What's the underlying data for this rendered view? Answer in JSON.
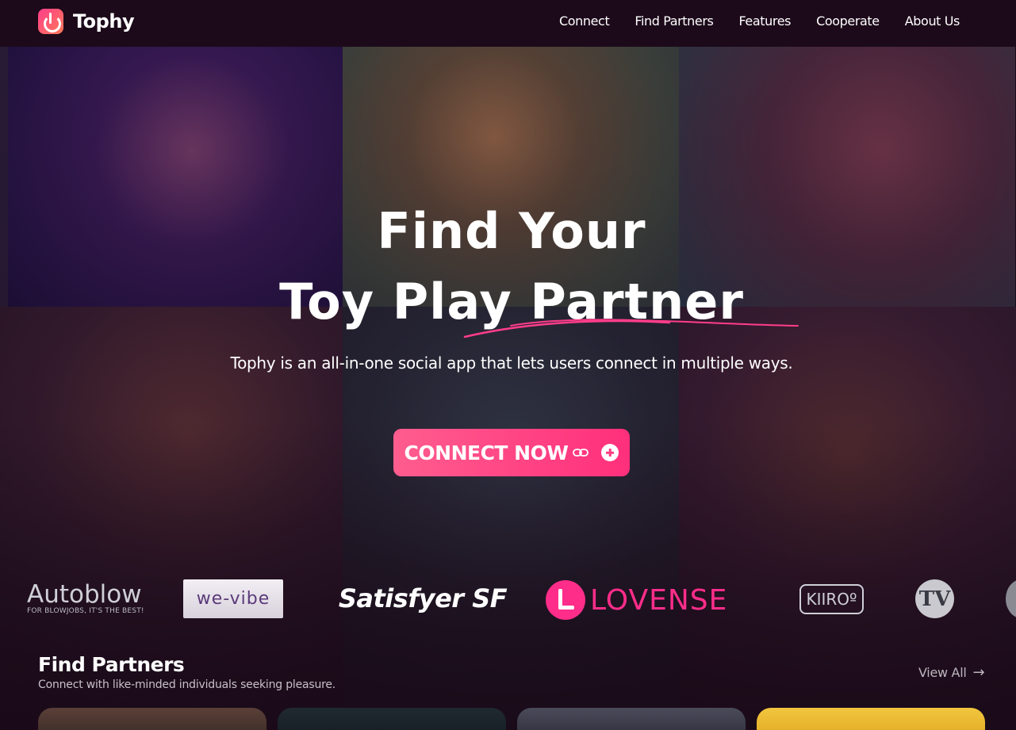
{
  "nav": {
    "brand": "Tophy",
    "links": [
      "Connect",
      "Find Partners",
      "Features",
      "Cooperate",
      "About Us"
    ]
  },
  "hero": {
    "title_line1": "Find Your",
    "title_line2": "Toy Play Partner",
    "subtitle": "Tophy is an all-in-one social app that lets users connect in multiple ways.",
    "cta_label": "CONNECT NOW",
    "accent_color": "#ff3d80"
  },
  "brands": {
    "autoblow": "Autoblow",
    "autoblow_tagline": "FOR BLOWJOBS, IT'S THE BEST!",
    "wevibe": "we-vibe",
    "satisfyer": "Satisfyer SF",
    "lovense": "LOVENSE",
    "kiiroo": "KIIROº",
    "tv_mark": "TV"
  },
  "find_partners": {
    "title": "Find Partners",
    "subtitle": "Connect with like-minded individuals seeking pleasure.",
    "view_all": "View All"
  }
}
